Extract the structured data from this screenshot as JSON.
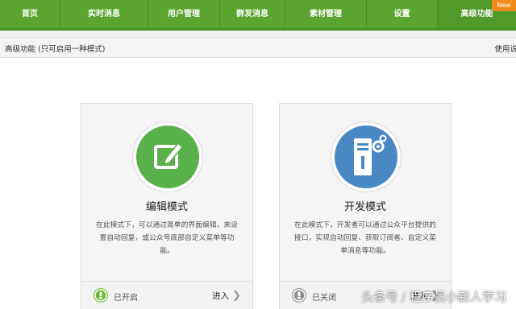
{
  "nav": {
    "items": [
      {
        "label": "首页"
      },
      {
        "label": "实时消息"
      },
      {
        "label": "用户管理"
      },
      {
        "label": "群发消息"
      },
      {
        "label": "素材管理"
      },
      {
        "label": "设置"
      },
      {
        "label": "高级功能"
      }
    ],
    "active_index": 6,
    "new_badge": "New"
  },
  "breadcrumb": {
    "title": "高级功能 (只可启用一种模式)",
    "right_text": "使用说"
  },
  "cards": [
    {
      "title": "编辑模式",
      "description": "在此模式下，可以通过简单的界面编辑，来设置自动回复，或公众号底部自定义菜单等功能。",
      "status": "已开启",
      "enter_label": "进入",
      "icon": "edit-icon",
      "accent": "#5ab04a"
    },
    {
      "title": "开发模式",
      "description": "在此模式下，开发者可以通过公众平台提供的接口，实现自动回复、获取订阅者、自定义菜单消息等功能。",
      "status": "已关闭",
      "enter_label": "进入",
      "icon": "server-gear-icon",
      "accent": "#4a88c4"
    }
  ],
  "colors": {
    "nav_green": "#5aa52f",
    "badge_orange": "#f28a1a"
  },
  "watermark": "头条号 / 程序员小新人学习"
}
